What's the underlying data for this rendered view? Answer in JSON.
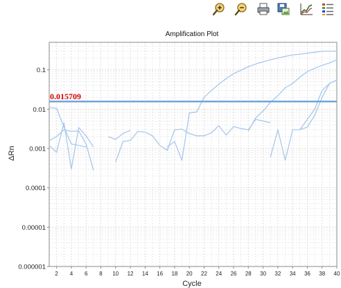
{
  "toolbar": {
    "icons": [
      "zoom-in-icon",
      "zoom-out-icon",
      "print-icon",
      "save-image-icon",
      "plot-settings-icon",
      "legend-icon"
    ]
  },
  "colors": {
    "curve": "#a8c8ec",
    "threshold": "#6fa4dc",
    "threshold_label": "#d40000",
    "grid": "#d6d6d6",
    "axis": "#888888"
  },
  "chart_data": {
    "type": "line",
    "title": "Amplification Plot",
    "xlabel": "Cycle",
    "ylabel": "ΔRn",
    "y_scale": "log",
    "xlim": [
      1,
      40
    ],
    "ylim": [
      1e-06,
      0.5
    ],
    "x_ticks": [
      "2",
      "4",
      "6",
      "8",
      "10",
      "12",
      "14",
      "16",
      "18",
      "20",
      "22",
      "24",
      "26",
      "28",
      "30",
      "32",
      "34",
      "36",
      "38",
      "40"
    ],
    "y_ticks": [
      {
        "value": 0.1,
        "label": "0.1"
      },
      {
        "value": 0.01,
        "label": "0.01"
      },
      {
        "value": 0.001,
        "label": "0.001"
      },
      {
        "value": 0.0001,
        "label": "0.0001"
      },
      {
        "value": 1e-05,
        "label": "0.00001"
      },
      {
        "value": 1e-06,
        "label": "0.000001"
      }
    ],
    "grid": true,
    "threshold": {
      "value": 0.0157,
      "label": "0.015709"
    },
    "series": [
      {
        "points": [
          [
            1,
            0.011
          ],
          [
            2,
            0.0105
          ],
          [
            3,
            0.0035
          ],
          [
            4,
            0.0013
          ],
          [
            5,
            0.0012
          ],
          [
            6,
            0.0011
          ]
        ]
      },
      {
        "points": [
          [
            1,
            0.0016
          ],
          [
            2,
            0.002
          ],
          [
            3,
            0.003
          ],
          [
            4,
            0.0027
          ],
          [
            5,
            0.0028
          ],
          [
            6,
            0.0013
          ],
          [
            7,
            0.00028
          ]
        ]
      },
      {
        "points": [
          [
            1,
            0.0012
          ],
          [
            2,
            0.0008
          ],
          [
            3,
            0.0045
          ],
          [
            4,
            0.0003
          ],
          [
            5,
            0.0034
          ],
          [
            6,
            0.0021
          ],
          [
            7,
            0.0011
          ]
        ]
      },
      {
        "points": [
          [
            9,
            0.002
          ],
          [
            10,
            0.0017
          ],
          [
            11,
            0.0024
          ],
          [
            12,
            0.0029
          ]
        ]
      },
      {
        "points": [
          [
            10,
            0.00045
          ],
          [
            11,
            0.0015
          ],
          [
            12,
            0.0016
          ],
          [
            13,
            0.0027
          ],
          [
            14,
            0.0026
          ],
          [
            15,
            0.0021
          ],
          [
            16,
            0.0012
          ],
          [
            17,
            0.0009
          ],
          [
            18,
            0.003
          ],
          [
            19,
            0.0031
          ],
          [
            20,
            0.0024
          ],
          [
            21,
            0.0021
          ],
          [
            22,
            0.0021
          ],
          [
            23,
            0.0025
          ],
          [
            24,
            0.0038
          ],
          [
            25,
            0.0022
          ],
          [
            26,
            0.0036
          ],
          [
            27,
            0.0032
          ],
          [
            28,
            0.003
          ],
          [
            29,
            0.0055
          ],
          [
            30,
            0.005
          ],
          [
            31,
            0.0045
          ]
        ]
      },
      {
        "points": [
          [
            17,
            0.0011
          ],
          [
            18,
            0.0015
          ],
          [
            19,
            0.0005
          ],
          [
            20,
            0.008
          ],
          [
            21,
            0.0085
          ],
          [
            22,
            0.02
          ],
          [
            23,
            0.03
          ],
          [
            24,
            0.043
          ],
          [
            25,
            0.06
          ],
          [
            26,
            0.08
          ],
          [
            27,
            0.098
          ],
          [
            28,
            0.12
          ],
          [
            29,
            0.14
          ],
          [
            30,
            0.16
          ],
          [
            31,
            0.18
          ],
          [
            32,
            0.2
          ],
          [
            33,
            0.22
          ],
          [
            34,
            0.24
          ],
          [
            35,
            0.25
          ],
          [
            36,
            0.265
          ],
          [
            37,
            0.28
          ],
          [
            38,
            0.295
          ],
          [
            39,
            0.3
          ],
          [
            40,
            0.3
          ]
        ]
      },
      {
        "points": [
          [
            31,
            0.0006
          ],
          [
            32,
            0.003
          ],
          [
            33,
            0.0005
          ],
          [
            34,
            0.003
          ],
          [
            35,
            0.003
          ],
          [
            36,
            0.0055
          ],
          [
            37,
            0.01
          ],
          [
            38,
            0.03
          ],
          [
            39,
            0.045
          ],
          [
            40,
            0.055
          ]
        ]
      },
      {
        "points": [
          [
            28,
            0.0028
          ],
          [
            29,
            0.006
          ],
          [
            30,
            0.009
          ],
          [
            31,
            0.015
          ],
          [
            32,
            0.022
          ],
          [
            33,
            0.035
          ],
          [
            34,
            0.045
          ],
          [
            35,
            0.065
          ],
          [
            36,
            0.09
          ],
          [
            37,
            0.11
          ],
          [
            38,
            0.13
          ],
          [
            39,
            0.15
          ],
          [
            40,
            0.18
          ]
        ]
      },
      {
        "points": [
          [
            35,
            0.003
          ],
          [
            36,
            0.0035
          ],
          [
            37,
            0.007
          ],
          [
            38,
            0.02
          ],
          [
            39,
            0.045
          ],
          [
            40,
            0.055
          ]
        ]
      }
    ]
  }
}
